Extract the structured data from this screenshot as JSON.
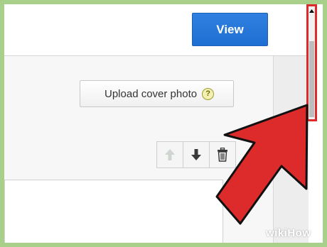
{
  "header": {
    "view_label": "View"
  },
  "cover": {
    "upload_label": "Upload cover photo",
    "help_glyph": "?"
  },
  "controls": {
    "icons": [
      "arrow-up-icon",
      "arrow-down-icon",
      "trash-icon"
    ]
  },
  "scrollbar": {
    "icons": [
      "scroll-up-arrow-icon"
    ]
  },
  "overlay": {
    "annotation": "red-pointer-arrow-icon",
    "highlight_color": "#dd2b2b"
  },
  "watermark": {
    "text": "wikiHow"
  },
  "colors": {
    "accent": "#1e6fd2",
    "background": "#a9d08b",
    "annotation_red": "#dd2b2b"
  }
}
